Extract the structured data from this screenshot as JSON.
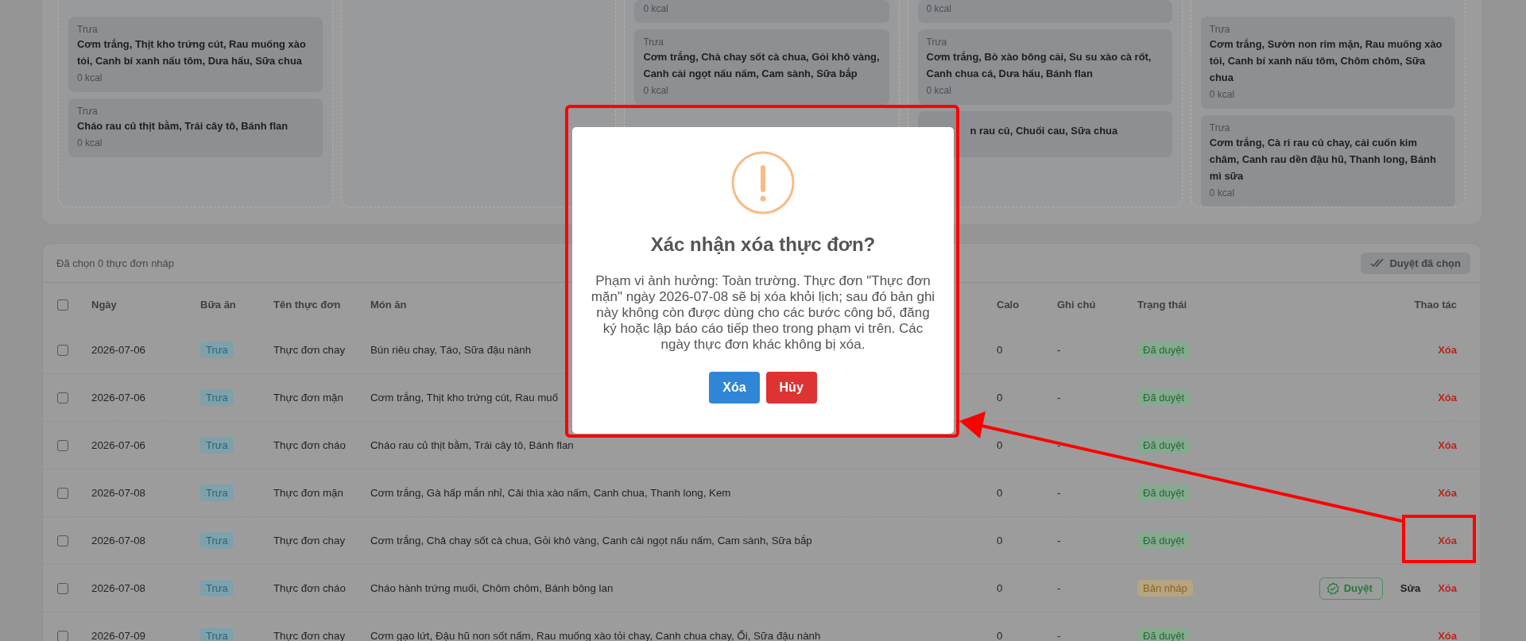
{
  "meal_board": {
    "days": [
      {
        "kind": "menu",
        "meals": [
          {
            "meal": "Trưa",
            "dishes": "Cơm trắng, Thịt kho trứng cút, Rau muống xào tỏi, Canh bí xanh nấu tôm, Dưa hấu, Sữa chua",
            "kcal": "0 kcal"
          },
          {
            "meal": "Trưa",
            "dishes": "Cháo rau củ thịt bằm, Trái cây tô, Bánh flan",
            "kcal": "0 kcal"
          }
        ]
      },
      {
        "kind": "empty"
      },
      {
        "kind": "menu",
        "meals": [
          {
            "kcal": "0 kcal"
          },
          {
            "meal": "Trưa",
            "dishes": "Cơm trắng, Chả chay sốt cà chua, Gỏi khô vàng, Canh cải ngọt nấu nấm, Cam sành, Sữa bắp",
            "kcal": "0 kcal"
          }
        ]
      },
      {
        "kind": "menu",
        "meals": [
          {
            "kcal": "0 kcal"
          },
          {
            "meal": "Trưa",
            "dishes": "Cơm trắng, Bò xào bông cải, Su su xào cà rốt, Canh chua cá, Dưa hấu, Bánh flan",
            "kcal": "0 kcal"
          },
          {
            "dishes": "n rau củ, Chuối cau, Sữa chua"
          }
        ]
      },
      {
        "kind": "menu",
        "meals": [
          {
            "meal": "Trưa",
            "dishes": "Cơm trắng, Sườn non rim mặn, Rau muống xào tỏi, Canh bí xanh nấu tôm, Chôm chôm, Sữa chua",
            "kcal": "0 kcal"
          },
          {
            "meal": "Trưa",
            "dishes": "Cơm trắng, Cà ri rau củ chay, cải cuốn kim châm, Canh rau dền đậu hũ, Thanh long, Bánh mì sữa",
            "kcal": "0 kcal"
          }
        ]
      }
    ]
  },
  "menu_table": {
    "selection_text": "Đã chọn 0 thực đơn nháp",
    "bulk_approve": {
      "label": "Duyệt đã chọn",
      "disabled": true
    },
    "select_all": {
      "checked": false
    },
    "columns": [
      "Ngày",
      "Bữa ăn",
      "Tên thực đơn",
      "Món ăn",
      "Calo",
      "Ghi chú",
      "Trạng thái",
      "Thao tác"
    ],
    "rows": [
      {
        "checked": false,
        "date": "2026-07-06",
        "meal": "Trưa",
        "menu": "Thực đơn chay",
        "dishes": "Bún riêu chay, Táo, Sữa đậu nành",
        "calo": "0",
        "note": "-",
        "status": {
          "label": "Đã duyệt",
          "kind": "approved"
        },
        "actions": [
          {
            "label": "Xóa",
            "kind": "delete"
          }
        ]
      },
      {
        "checked": false,
        "date": "2026-07-06",
        "meal": "Trưa",
        "menu": "Thực đơn mặn",
        "dishes": "Cơm trắng, Thịt kho trứng cút, Rau muố",
        "calo": "0",
        "note": "-",
        "status": {
          "label": "Đã duyệt",
          "kind": "approved"
        },
        "actions": [
          {
            "label": "Xóa",
            "kind": "delete"
          }
        ]
      },
      {
        "checked": false,
        "date": "2026-07-06",
        "meal": "Trưa",
        "menu": "Thực đơn cháo",
        "dishes": "Cháo rau củ thịt bằm, Trái cây tô, Bánh flan",
        "calo": "0",
        "note": "-",
        "status": {
          "label": "Đã duyệt",
          "kind": "approved"
        },
        "actions": [
          {
            "label": "Xóa",
            "kind": "delete"
          }
        ]
      },
      {
        "checked": false,
        "date": "2026-07-08",
        "meal": "Trưa",
        "menu": "Thực đơn mặn",
        "dishes": "Cơm trắng, Gà hấp mắn nhỉ, Cải thìa xào nấm, Canh chua, Thanh long, Kem",
        "calo": "0",
        "note": "-",
        "status": {
          "label": "Đã duyệt",
          "kind": "approved"
        },
        "actions": [
          {
            "label": "Xóa",
            "kind": "delete"
          }
        ]
      },
      {
        "checked": false,
        "date": "2026-07-08",
        "meal": "Trưa",
        "menu": "Thực đơn chay",
        "dishes": "Cơm trắng, Chả chay sốt cà chua, Gỏi khô vàng, Canh cải ngọt nấu nấm, Cam sành, Sữa bắp",
        "calo": "0",
        "note": "-",
        "status": {
          "label": "Đã duyệt",
          "kind": "approved"
        },
        "actions": [
          {
            "label": "Xóa",
            "kind": "delete"
          }
        ]
      },
      {
        "checked": false,
        "date": "2026-07-08",
        "meal": "Trưa",
        "menu": "Thực đơn cháo",
        "dishes": "Cháo hành trứng muối, Chôm chôm, Bánh bông lan",
        "calo": "0",
        "note": "-",
        "status": {
          "label": "Bản nháp",
          "kind": "draft"
        },
        "actions": [
          {
            "label": "Duyệt",
            "kind": "approve"
          },
          {
            "label": "Sửa",
            "kind": "edit"
          },
          {
            "label": "Xóa",
            "kind": "delete"
          }
        ]
      },
      {
        "checked": false,
        "date": "2026-07-09",
        "meal": "Trưa",
        "menu": "Thực đơn chay",
        "dishes": "Cơm gạo lứt, Đậu hũ non sốt nấm, Rau muống xào tỏi chay, Canh chua chay, Ổi, Sữa đậu nành",
        "calo": "0",
        "note": "-",
        "status": {
          "label": "Đã duyệt",
          "kind": "approved"
        },
        "actions": [
          {
            "label": "Xóa",
            "kind": "delete"
          }
        ]
      }
    ]
  },
  "confirm_dialog": {
    "title": "Xác nhận xóa thực đơn?",
    "message": "Phạm vi ảnh hưởng: Toàn trường. Thực đơn \"Thực đơn mặn\" ngày 2026-07-08 sẽ bị xóa khỏi lịch; sau đó bản ghi này không còn được dùng cho các bước công bố, đăng ký hoặc lập báo cáo tiếp theo trong phạm vi trên. Các ngày thực đơn khác không bị xóa.",
    "buttons": [
      {
        "label": "Xóa",
        "kind": "confirm"
      },
      {
        "label": "Hủy",
        "kind": "cancel"
      }
    ]
  }
}
